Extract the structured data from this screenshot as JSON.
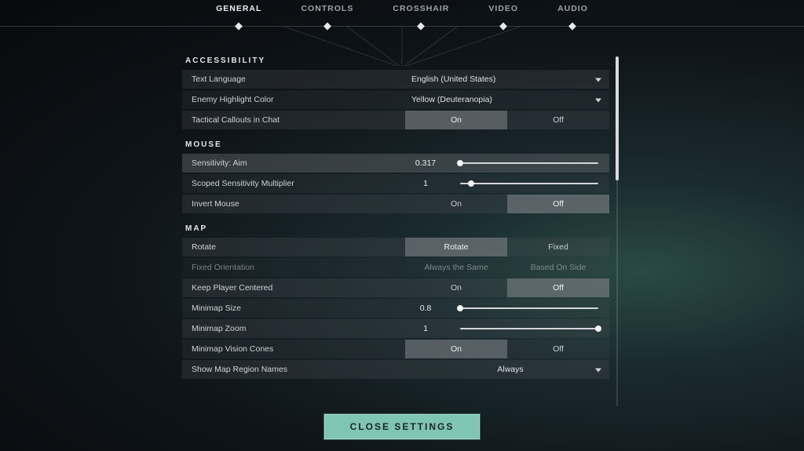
{
  "nav": {
    "items": [
      "GENERAL",
      "CONTROLS",
      "CROSSHAIR",
      "VIDEO",
      "AUDIO"
    ],
    "active": 0
  },
  "sections": {
    "accessibility": {
      "title": "ACCESSIBILITY",
      "text_language": {
        "label": "Text Language",
        "value": "English (United States)"
      },
      "enemy_highlight": {
        "label": "Enemy Highlight Color",
        "value": "Yellow (Deuteranopia)"
      },
      "tactical_callouts": {
        "label": "Tactical Callouts in Chat",
        "on": "On",
        "off": "Off",
        "selected": "On"
      }
    },
    "mouse": {
      "title": "MOUSE",
      "sensitivity": {
        "label": "Sensitivity: Aim",
        "value": "0.317",
        "pos": 0
      },
      "scoped_mult": {
        "label": "Scoped Sensitivity Multiplier",
        "value": "1",
        "pos": 8
      },
      "invert": {
        "label": "Invert Mouse",
        "on": "On",
        "off": "Off",
        "selected": "Off"
      }
    },
    "map": {
      "title": "MAP",
      "rotate": {
        "label": "Rotate",
        "a": "Rotate",
        "b": "Fixed",
        "selected": "Rotate"
      },
      "fixed_orient": {
        "label": "Fixed Orientation",
        "a": "Always the Same",
        "b": "Based On Side",
        "disabled": true
      },
      "keep_centered": {
        "label": "Keep Player Centered",
        "on": "On",
        "off": "Off",
        "selected": "Off"
      },
      "minimap_size": {
        "label": "Minimap Size",
        "value": "0.8",
        "pos": 0
      },
      "minimap_zoom": {
        "label": "Minimap Zoom",
        "value": "1",
        "pos": 100
      },
      "vision_cones": {
        "label": "Minimap Vision Cones",
        "on": "On",
        "off": "Off",
        "selected": "On"
      },
      "region_names": {
        "label": "Show Map Region Names",
        "value": "Always"
      }
    }
  },
  "close_label": "CLOSE SETTINGS"
}
